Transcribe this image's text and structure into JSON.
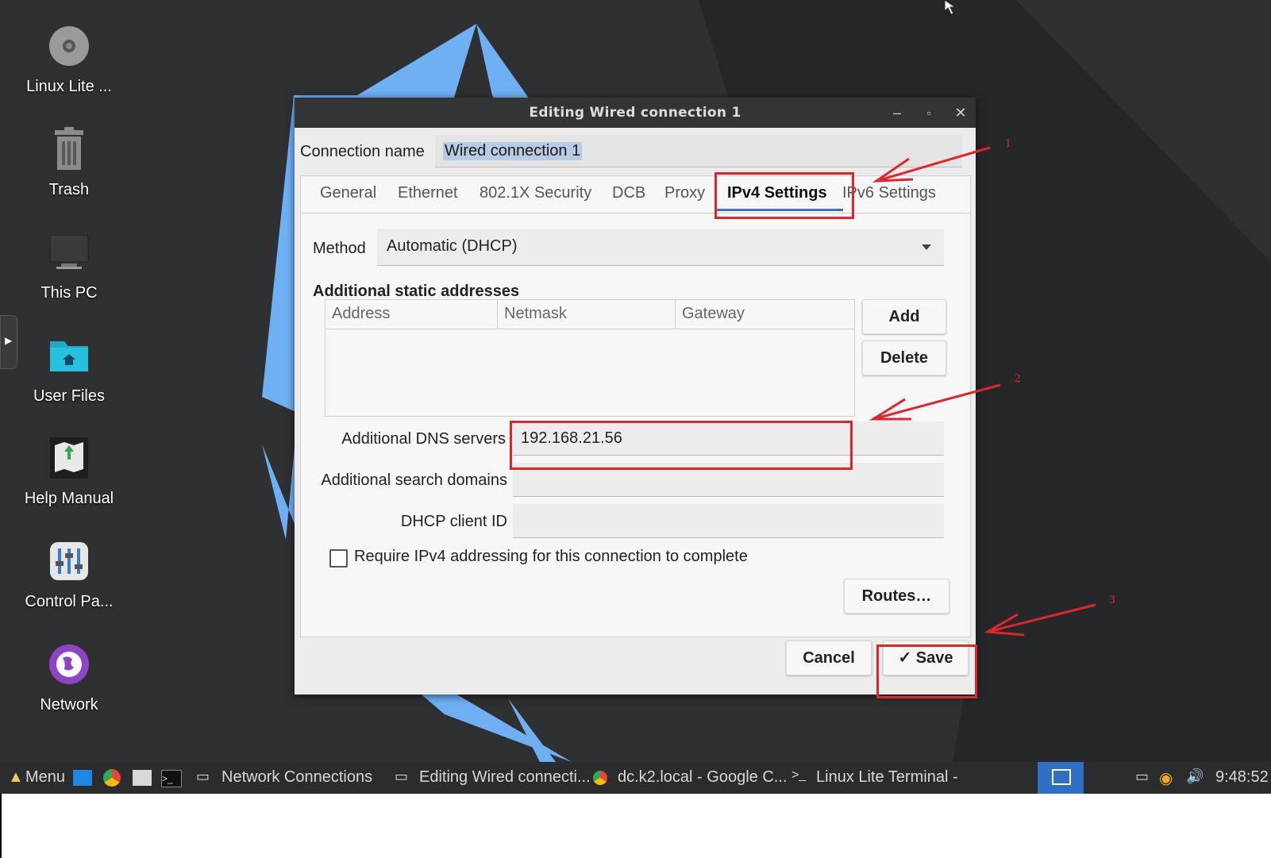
{
  "desktop": {
    "icons": [
      {
        "label": "Linux Lite ...",
        "icon": "disc-icon"
      },
      {
        "label": "Trash",
        "icon": "trash-icon"
      },
      {
        "label": "This PC",
        "icon": "monitor-icon"
      },
      {
        "label": "User Files",
        "icon": "home-folder-icon"
      },
      {
        "label": "Help Manual",
        "icon": "help-manual-icon"
      },
      {
        "label": "Control Pa...",
        "icon": "control-panel-icon"
      },
      {
        "label": "Network",
        "icon": "network-globe-icon"
      }
    ]
  },
  "dialog": {
    "title": "Editing Wired connection 1",
    "connection_name_label": "Connection name",
    "connection_name_value": "Wired connection 1",
    "tabs": [
      "General",
      "Ethernet",
      "802.1X Security",
      "DCB",
      "Proxy",
      "IPv4 Settings",
      "IPv6 Settings"
    ],
    "active_tab": "IPv4 Settings",
    "method_label": "Method",
    "method_value": "Automatic (DHCP)",
    "static_title": "Additional static addresses",
    "columns": [
      "Address",
      "Netmask",
      "Gateway"
    ],
    "add_label": "Add",
    "delete_label": "Delete",
    "dns_label": "Additional DNS servers",
    "dns_value": "192.168.21.56",
    "search_label": "Additional search domains",
    "search_value": "",
    "dhcp_label": "DHCP client ID",
    "dhcp_value": "",
    "require_label": "Require IPv4 addressing for this connection to complete",
    "require_checked": false,
    "routes_label": "Routes…",
    "cancel_label": "Cancel",
    "save_label": "Save"
  },
  "taskbar": {
    "menu_label": "Menu",
    "items": [
      "Network Connections",
      "Editing Wired connecti...",
      "dc.k2.local - Google C...",
      "Linux Lite Terminal -"
    ],
    "clock": "9:48:52"
  },
  "annotations": [
    "1",
    "2",
    "3"
  ],
  "colors": {
    "annotation": "#e0262b",
    "accent": "#3b6fd4",
    "wallpaper_blue": "#6fb0f5"
  }
}
